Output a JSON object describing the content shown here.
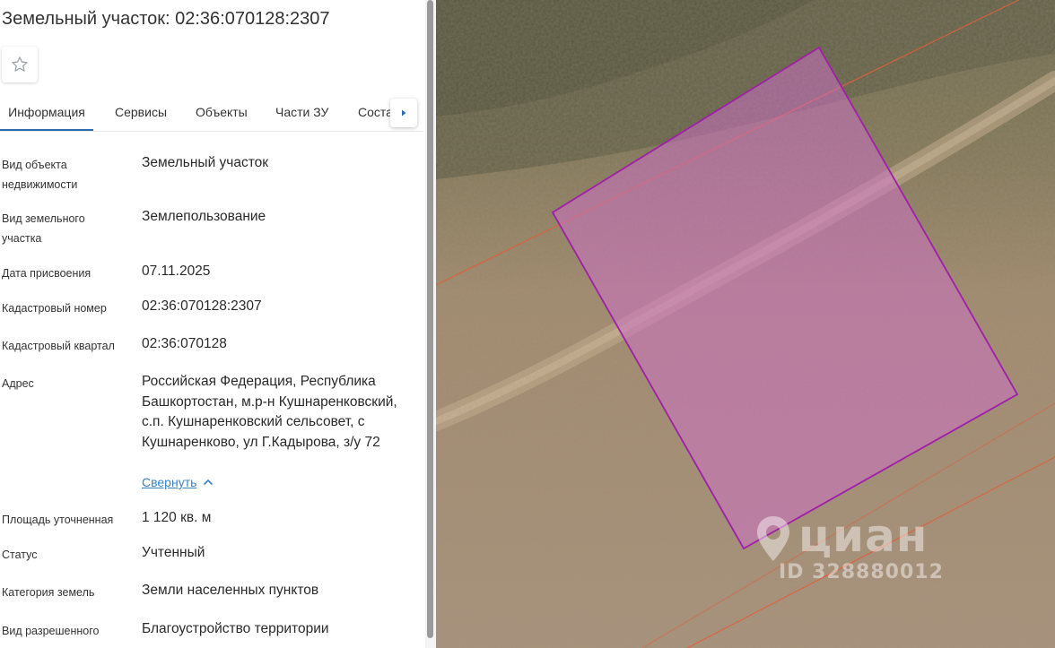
{
  "header": {
    "title": "Земельный участок: 02:36:070128:2307"
  },
  "favorite": {
    "icon": "star-outline-icon"
  },
  "tabs": [
    {
      "label": "Информация",
      "active": true
    },
    {
      "label": "Сервисы",
      "active": false
    },
    {
      "label": "Объекты",
      "active": false
    },
    {
      "label": "Части ЗУ",
      "active": false
    },
    {
      "label": "Соста",
      "active": false
    }
  ],
  "tab_scroll": {
    "icon": "triangle-right-icon"
  },
  "info": {
    "rows": [
      {
        "label": "Вид объекта недвижимости",
        "value": "Земельный участок"
      },
      {
        "label": "Вид земельного участка",
        "value": "Землепользование"
      },
      {
        "label": "Дата присвоения",
        "value": "07.11.2025"
      },
      {
        "label": "Кадастровый номер",
        "value": "02:36:070128:2307"
      },
      {
        "label": "Кадастровый квартал",
        "value": "02:36:070128"
      },
      {
        "label": "Адрес",
        "value": "Российская Федерация, Республика Башкортостан, м.р-н Кушнаренковский, с.п. Кушнаренковский сельсовет, с Кушнаренково, ул Г.Кадырова, з/у 72"
      },
      {
        "label": "Площадь уточненная",
        "value": "1 120 кв. м"
      },
      {
        "label": "Статус",
        "value": "Учтенный"
      },
      {
        "label": "Категория земель",
        "value": "Земли населенных пунктов"
      },
      {
        "label": "Вид разрешенного",
        "value": "Благоустройство территории"
      }
    ],
    "collapse_label": "Свернуть",
    "collapse_icon": "chevron-up-icon"
  },
  "map": {
    "parcel_fill": "#d070c8",
    "parcel_stroke": "#a01fa8",
    "boundary_color": "#e0603a",
    "watermark": {
      "brand": "циан",
      "id": "ID 328880012",
      "icon": "location-pin-icon"
    }
  },
  "colors": {
    "accent": "#2b6cb0",
    "link": "#3b82c4"
  }
}
